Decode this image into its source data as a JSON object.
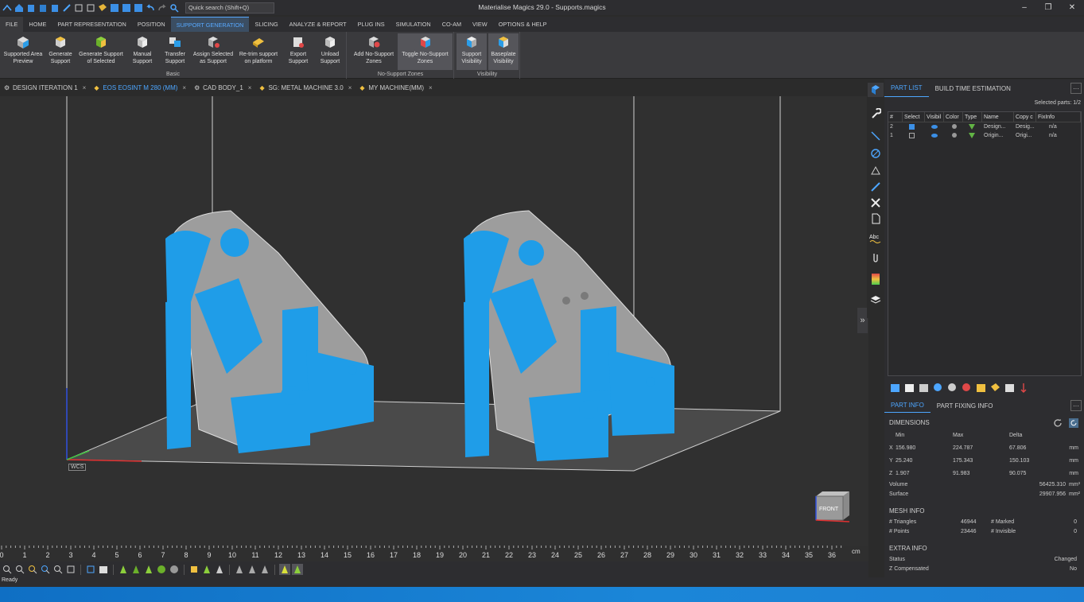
{
  "app": {
    "title": "Materialise Magics 29.0 - Supports.magics",
    "quick_search_placeholder": "Quick search (Shift+Q)"
  },
  "ribbon_tabs": [
    "FILE",
    "HOME",
    "PART REPRESENTATION",
    "POSITION",
    "SUPPORT GENERATION",
    "SLICING",
    "ANALYZE & REPORT",
    "PLUG INS",
    "SIMULATION",
    "CO-AM",
    "VIEW",
    "OPTIONS & HELP"
  ],
  "ribbon": {
    "buttons": [
      {
        "label": "Supported Area\nPreview"
      },
      {
        "label": "Generate\nSupport"
      },
      {
        "label": "Generate Support\nof Selected"
      },
      {
        "label": "Manual\nSupport"
      },
      {
        "label": "Transfer\nSupport"
      },
      {
        "label": "Assign Selected\nas Support"
      },
      {
        "label": "Re-trim support\non platform"
      },
      {
        "label": "Export\nSupport"
      },
      {
        "label": "Unload\nSupport"
      },
      {
        "label": "Add No-Support\nZones"
      },
      {
        "label": "Toggle No-Support\nZones"
      },
      {
        "label": "Support\nVisibility"
      },
      {
        "label": "Baseplate\nVisibility"
      }
    ],
    "groups": {
      "basic": "Basic",
      "no_support": "No-Support Zones",
      "visibility": "Visibility"
    }
  },
  "doc_tabs": [
    "DESIGN ITERATION 1",
    "EOS EOSINT M 280 (MM)",
    "CAD BODY_1",
    "SG: METAL MACHINE 3.0",
    "MY MACHINE(MM)"
  ],
  "viewport": {
    "wcs_label": "WCS",
    "viewcube_label": "FRONT",
    "ruler_ticks": [
      "0",
      "1",
      "2",
      "3",
      "4",
      "5",
      "6",
      "7",
      "8",
      "9",
      "10",
      "11",
      "12",
      "13",
      "14",
      "15",
      "16",
      "17",
      "18",
      "19",
      "20",
      "21",
      "22",
      "23",
      "24",
      "25",
      "26",
      "27",
      "28",
      "29",
      "30",
      "31",
      "32",
      "33",
      "34",
      "35",
      "36"
    ],
    "ruler_unit": "cm",
    "expand_glyph": "»"
  },
  "status": "Ready",
  "colors": {
    "accent": "#3b8fe6",
    "support_blue": "#1f9de8",
    "part_gray": "#9a9a9a"
  },
  "right_panel": {
    "tabs": [
      "PART LIST",
      "BUILD TIME ESTIMATION"
    ],
    "more_glyph": "···",
    "selected_parts": "Selected parts:  1/2",
    "table": {
      "headers": [
        "#",
        "Select",
        "Visibil",
        "Color",
        "Type",
        "Name",
        "Copy c",
        "FixInfo"
      ],
      "rows": [
        {
          "num": "2",
          "selected": true,
          "name": "Design...",
          "copy": "Desig...",
          "fix": "n/a"
        },
        {
          "num": "1",
          "selected": false,
          "name": "Origin...",
          "copy": "Origi...",
          "fix": "n/a"
        }
      ]
    },
    "info_tabs": [
      "PART INFO",
      "PART FIXING INFO"
    ],
    "dimensions": {
      "title": "DIMENSIONS",
      "headers": [
        "Min",
        "Max",
        "Delta"
      ],
      "rows": [
        {
          "axis": "X",
          "min": "156.980",
          "max": "224.787",
          "delta": "67.806",
          "unit": "mm"
        },
        {
          "axis": "Y",
          "min": "25.240",
          "max": "175.343",
          "delta": "150.103",
          "unit": "mm"
        },
        {
          "axis": "Z",
          "min": "1.907",
          "max": "91.983",
          "delta": "90.075",
          "unit": "mm"
        }
      ],
      "volume_label": "Volume",
      "volume": "56425.310",
      "volume_unit": "mm³",
      "surface_label": "Surface",
      "surface": "29907.956",
      "surface_unit": "mm²"
    },
    "mesh_info": {
      "title": "MESH INFO",
      "triangles_label": "# Triangles",
      "triangles": "46944",
      "marked_label": "# Marked",
      "marked": "0",
      "points_label": "# Points",
      "points": "23446",
      "invisible_label": "# Invisible",
      "invisible": "0"
    },
    "extra_info": {
      "title": "EXTRA INFO",
      "status_label": "Status",
      "status": "Changed",
      "zcomp_label": "Z Compensated",
      "zcomp": "No"
    }
  }
}
